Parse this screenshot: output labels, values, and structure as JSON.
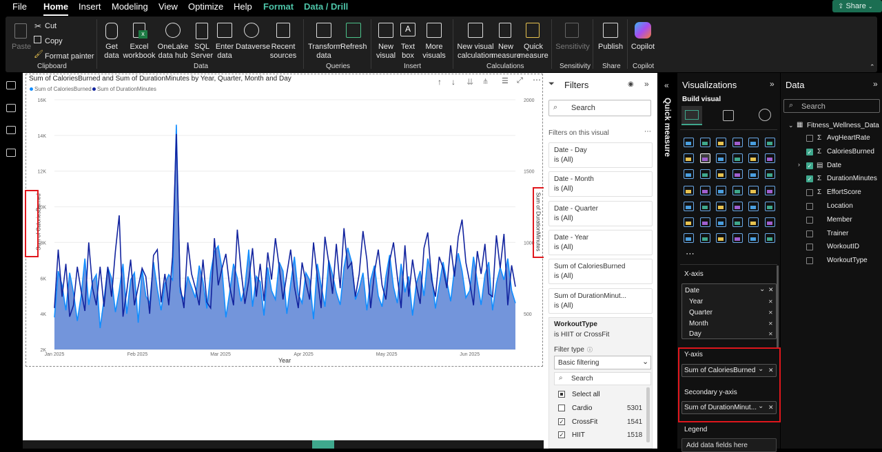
{
  "menu": {
    "file": "File",
    "home": "Home",
    "insert": "Insert",
    "modeling": "Modeling",
    "view": "View",
    "optimize": "Optimize",
    "help": "Help",
    "format": "Format",
    "data_drill": "Data / Drill",
    "share": "Share"
  },
  "ribbon": {
    "paste": "Paste",
    "cut": "Cut",
    "copy": "Copy",
    "format_painter": "Format painter",
    "clipboard": "Clipboard",
    "get_data": "Get data",
    "excel": "Excel workbook",
    "onelake": "OneLake data hub",
    "sql": "SQL Server",
    "enter_data": "Enter data",
    "dataverse": "Dataverse",
    "recent": "Recent sources",
    "data_group": "Data",
    "transform": "Transform data",
    "refresh": "Refresh",
    "queries": "Queries",
    "new_visual": "New visual",
    "text_box": "Text box",
    "more_visuals": "More visuals",
    "insert_group": "Insert",
    "new_visual_calc": "New visual calculation",
    "new_measure": "New measure",
    "quick_measure": "Quick measure",
    "calculations": "Calculations",
    "sensitivity": "Sensitivity",
    "sensitivity_group": "Sensitivity",
    "publish": "Publish",
    "share_group": "Share",
    "copilot": "Copilot",
    "copilot_group": "Copilot"
  },
  "chart_data": {
    "type": "area",
    "title": "Sum of CaloriesBurned and Sum of DurationMinutes by Year, Quarter, Month and Day",
    "xlabel": "Year",
    "ylabel": "Sum of CaloriesBurned",
    "y2label": "Sum of DurationMinutes",
    "ylim": [
      2000,
      16000
    ],
    "y2lim": [
      250,
      2000
    ],
    "yticks": [
      "2K",
      "4K",
      "6K",
      "8K",
      "10K",
      "12K",
      "14K",
      "16K"
    ],
    "y2ticks": [
      "500",
      "1000",
      "1500",
      "2000"
    ],
    "xticks": [
      "Jan 2025",
      "Feb 2025",
      "Mar 2025",
      "Apr 2025",
      "May 2025",
      "Jun 2025"
    ],
    "legend_position": "top-left",
    "colors": {
      "calories": "#118dff",
      "duration": "#12239e",
      "area": "#6b8fd9"
    },
    "series": [
      {
        "name": "Sum of CaloriesBurned",
        "values": [
          3800,
          6400,
          5600,
          4200,
          6300,
          5200,
          3600,
          5000,
          7100,
          4500,
          5800,
          6200,
          3200,
          4800,
          6600,
          6000,
          4100,
          5300,
          6800,
          4000,
          5900,
          6300,
          3500,
          6500,
          5000,
          4600,
          6900,
          5400,
          4200,
          5700,
          6200,
          5900,
          14600,
          5200,
          4800,
          6100,
          5500,
          4900,
          6700,
          5800,
          4300,
          6300,
          7500,
          7800,
          6500,
          3800,
          5200,
          6800,
          6000,
          4700,
          5500,
          7600,
          4400,
          6100,
          5800,
          3900,
          6600,
          5300,
          4800,
          6900,
          6400,
          4000,
          5700,
          7200,
          5100,
          4600,
          6300,
          5900,
          3700,
          6800,
          5600,
          4400,
          7000,
          6200,
          5200,
          4500,
          6600,
          7700,
          6900,
          4800,
          5400,
          6300,
          4200,
          5900,
          6700,
          5000,
          4400,
          6100,
          7300,
          5500,
          4600,
          6800,
          5200,
          6100,
          3900,
          5700,
          6400,
          5000,
          7100,
          6200,
          4300,
          5600,
          6900,
          5800,
          4700,
          6500,
          7400,
          6400,
          4900,
          5300,
          7200,
          5800,
          4500,
          6200,
          6900,
          4200,
          5700,
          6600,
          5900,
          7100,
          5300,
          4600
        ]
      },
      {
        "name": "Sum of DurationMinutes",
        "values": [
          540,
          950,
          620,
          850,
          480,
          560,
          830,
          660,
          520,
          1000,
          680,
          560,
          830,
          550,
          830,
          620,
          940,
          1190,
          480,
          660,
          880,
          560,
          690,
          820,
          760,
          500,
          910,
          950,
          580,
          780,
          560,
          900,
          1760,
          690,
          540,
          1000,
          780,
          680,
          560,
          880,
          580,
          540,
          1030,
          700,
          820,
          920,
          690,
          560,
          1090,
          800,
          570,
          730,
          960,
          620,
          850,
          590,
          930,
          740,
          1030,
          830,
          600,
          780,
          950,
          690,
          540,
          860,
          720,
          600,
          1000,
          760,
          540,
          1040,
          860,
          640,
          990,
          680,
          1100,
          820,
          860,
          620,
          780,
          1080,
          880,
          540,
          790,
          950,
          700,
          600,
          870,
          1000,
          760,
          540,
          980,
          620,
          880,
          700,
          570,
          960,
          1070,
          740,
          620,
          900,
          820,
          680,
          980,
          760,
          1040,
          1160,
          860,
          720,
          560,
          940,
          780,
          990,
          640,
          620,
          1050,
          820,
          1060,
          560,
          840,
          690
        ]
      }
    ]
  },
  "filters": {
    "title": "Filters",
    "search": "Search",
    "on_visual": "Filters on this visual",
    "cards": [
      {
        "name": "Date - Day",
        "value": "is (All)"
      },
      {
        "name": "Date - Month",
        "value": "is (All)"
      },
      {
        "name": "Date - Quarter",
        "value": "is (All)"
      },
      {
        "name": "Date - Year",
        "value": "is (All)"
      },
      {
        "name": "Sum of CaloriesBurned",
        "value": "is (All)"
      },
      {
        "name": "Sum of DurationMinut...",
        "value": "is (All)"
      }
    ],
    "workout": {
      "name": "WorkoutType",
      "value": "is HIIT or CrossFit",
      "filter_type_label": "Filter type",
      "filter_type": "Basic filtering",
      "search": "Search",
      "select_all": "Select all",
      "items": [
        {
          "label": "Cardio",
          "count": "5301",
          "checked": false
        },
        {
          "label": "CrossFit",
          "count": "1541",
          "checked": true
        },
        {
          "label": "HIIT",
          "count": "1518",
          "checked": true
        }
      ]
    }
  },
  "quick_measure": "Quick measure",
  "viz": {
    "title": "Visualizations",
    "build_visual": "Build visual",
    "xaxis": "X-axis",
    "x_field": "Date",
    "x_levels": [
      "Year",
      "Quarter",
      "Month",
      "Day"
    ],
    "yaxis": "Y-axis",
    "y_field": "Sum of CaloriesBurned",
    "y2axis": "Secondary y-axis",
    "y2_field": "Sum of DurationMinut...",
    "legend": "Legend",
    "legend_placeholder": "Add data fields here"
  },
  "datapane": {
    "title": "Data",
    "search": "Search",
    "table": "Fitness_Wellness_Data",
    "fields": [
      {
        "label": "AvgHeartRate",
        "sigma": true,
        "checked": false
      },
      {
        "label": "CaloriesBurned",
        "sigma": true,
        "checked": true
      },
      {
        "label": "Date",
        "sigma": false,
        "checked": true,
        "expand": true
      },
      {
        "label": "DurationMinutes",
        "sigma": true,
        "checked": true
      },
      {
        "label": "EffortScore",
        "sigma": true,
        "checked": false
      },
      {
        "label": "Location",
        "sigma": false,
        "checked": false
      },
      {
        "label": "Member",
        "sigma": false,
        "checked": false
      },
      {
        "label": "Trainer",
        "sigma": false,
        "checked": false
      },
      {
        "label": "WorkoutID",
        "sigma": false,
        "checked": false
      },
      {
        "label": "WorkoutType",
        "sigma": false,
        "checked": false
      }
    ]
  }
}
